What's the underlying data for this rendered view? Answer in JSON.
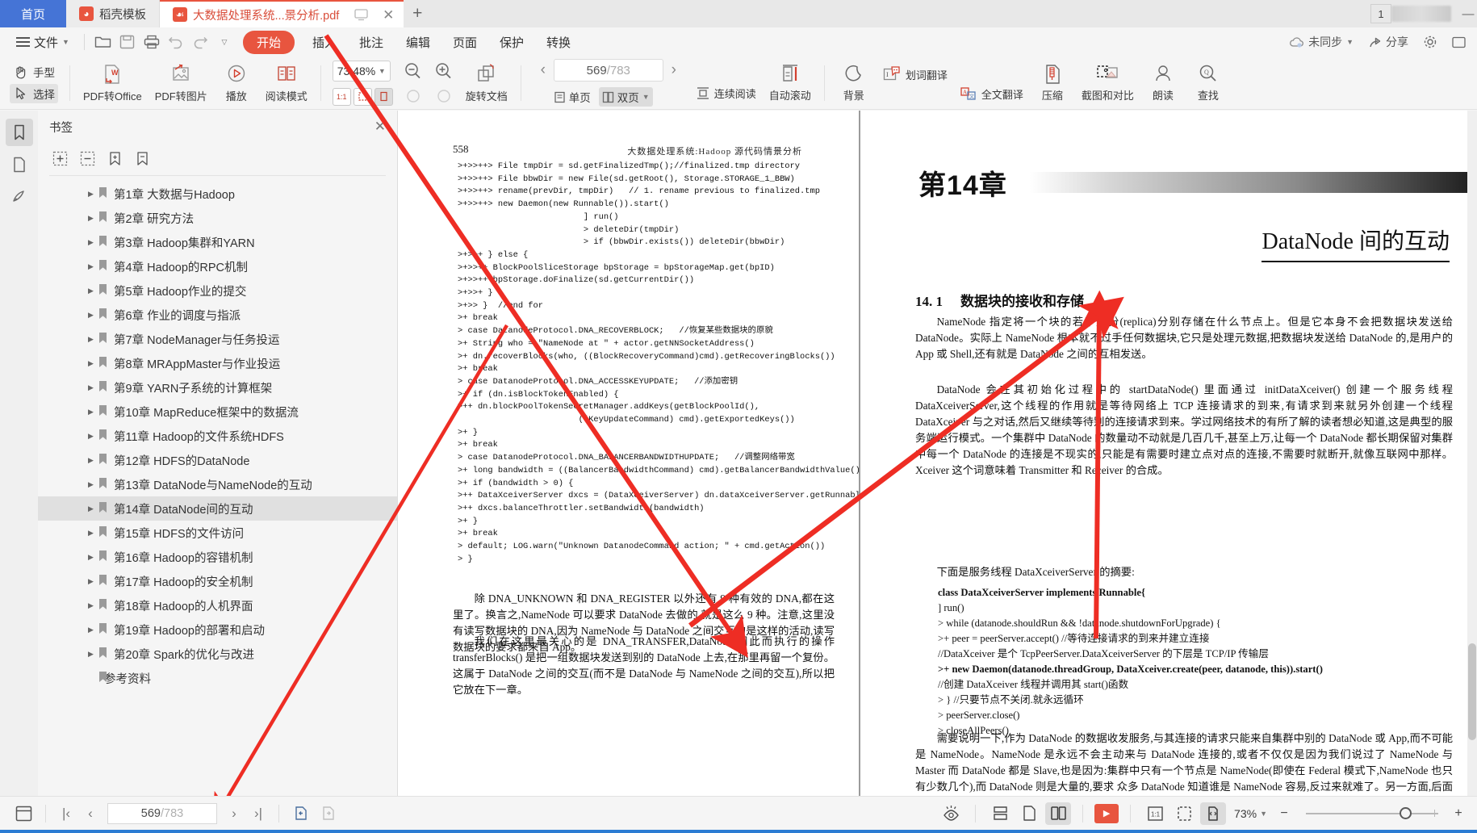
{
  "window": {
    "tabs": [
      {
        "label": "首页",
        "type": "home",
        "icon": "home-tab"
      },
      {
        "label": "稻壳模板",
        "type": "inactive",
        "icon": "wps-docer-icon"
      },
      {
        "label": "大数据处理系统...景分析.pdf",
        "type": "active",
        "icon": "pdf-icon"
      }
    ],
    "new_tab_label": "+",
    "badge": "1"
  },
  "menubar": {
    "file_label": "文件",
    "quick_icons": [
      "open-folder-icon",
      "save-icon",
      "print-icon",
      "undo-icon",
      "redo-icon",
      "customize-caret-icon"
    ],
    "tabs": [
      {
        "label": "开始",
        "active": true
      },
      {
        "label": "插入",
        "active": false
      },
      {
        "label": "批注",
        "active": false
      },
      {
        "label": "编辑",
        "active": false
      },
      {
        "label": "页面",
        "active": false
      },
      {
        "label": "保护",
        "active": false
      },
      {
        "label": "转换",
        "active": false
      }
    ],
    "right": [
      {
        "label": "未同步",
        "icon": "cloud-sync-icon"
      },
      {
        "label": "分享",
        "icon": "share-icon"
      },
      {
        "label": "",
        "icon": "gear-icon"
      },
      {
        "label": "",
        "icon": "window-icon"
      }
    ]
  },
  "ribbon": {
    "hand_tool": "手型",
    "select_tool": "选择",
    "buttons": [
      {
        "label": "PDF转Office",
        "icon": "pdf-to-office-icon",
        "dropdown": true
      },
      {
        "label": "PDF转图片",
        "icon": "pdf-to-image-icon",
        "dropdown": false
      },
      {
        "label": "播放",
        "icon": "play-circle-icon",
        "dropdown": false
      },
      {
        "label": "阅读模式",
        "icon": "reading-mode-icon",
        "dropdown": false
      }
    ],
    "zoom_value": "73.48%",
    "view_modes": [
      "1:1",
      "fit-page",
      "fit-width"
    ],
    "zoom_out_icon": "zoom-out-icon",
    "zoom_in_icon": "zoom-in-icon",
    "rotate_label": "旋转文档",
    "page_current": "569",
    "page_total": "783",
    "page_sep": "/",
    "single_page": "单页",
    "double_page": "双页",
    "continuous": "连续阅读",
    "autoscroll": "自动滚动",
    "background": "背景",
    "word_translate": "划词翻译",
    "full_translate": "全文翻译",
    "compress": "压缩",
    "screenshot_compare": "截图和对比",
    "read_aloud": "朗读",
    "find": "查找"
  },
  "rail": {
    "items": [
      {
        "icon": "bookmark-icon",
        "active": true
      },
      {
        "icon": "page-thumbnail-icon",
        "active": false
      },
      {
        "icon": "annotation-icon",
        "active": false
      }
    ]
  },
  "bookmarks": {
    "title": "书签",
    "close_icon": "close-icon",
    "tools": [
      "add-bookmark-icon",
      "remove-bookmark-icon",
      "edit-bookmark-icon",
      "goto-bookmark-icon"
    ],
    "items": [
      {
        "label": "第1章  大数据与Hadoop",
        "selected": false,
        "leaf": false
      },
      {
        "label": "第2章  研究方法",
        "selected": false,
        "leaf": false
      },
      {
        "label": "第3章  Hadoop集群和YARN",
        "selected": false,
        "leaf": false
      },
      {
        "label": "第4章  Hadoop的RPC机制",
        "selected": false,
        "leaf": false
      },
      {
        "label": "第5章  Hadoop作业的提交",
        "selected": false,
        "leaf": false
      },
      {
        "label": "第6章  作业的调度与指派",
        "selected": false,
        "leaf": false
      },
      {
        "label": "第7章  NodeManager与任务投运",
        "selected": false,
        "leaf": false
      },
      {
        "label": "第8章  MRAppMaster与作业投运",
        "selected": false,
        "leaf": false
      },
      {
        "label": "第9章  YARN子系统的计算框架",
        "selected": false,
        "leaf": false
      },
      {
        "label": "第10章  MapReduce框架中的数据流",
        "selected": false,
        "leaf": false
      },
      {
        "label": "第11章  Hadoop的文件系统HDFS",
        "selected": false,
        "leaf": false
      },
      {
        "label": "第12章  HDFS的DataNode",
        "selected": false,
        "leaf": false
      },
      {
        "label": "第13章  DataNode与NameNode的互动",
        "selected": false,
        "leaf": false
      },
      {
        "label": "第14章  DataNode间的互动",
        "selected": true,
        "leaf": false
      },
      {
        "label": "第15章  HDFS的文件访问",
        "selected": false,
        "leaf": false
      },
      {
        "label": "第16章  Hadoop的容错机制",
        "selected": false,
        "leaf": false
      },
      {
        "label": "第17章  Hadoop的安全机制",
        "selected": false,
        "leaf": false
      },
      {
        "label": "第18章  Hadoop的人机界面",
        "selected": false,
        "leaf": false
      },
      {
        "label": "第19章  Hadoop的部署和启动",
        "selected": false,
        "leaf": false
      },
      {
        "label": "第20章  Spark的优化与改进",
        "selected": false,
        "leaf": false
      },
      {
        "label": "参考资料",
        "selected": false,
        "leaf": true
      }
    ]
  },
  "document": {
    "left_page": {
      "page_number": "558",
      "running_head": "大数据处理系统:Hadoop 源代码情景分析",
      "code": ">+>>++> File tmpDir = sd.getFinalizedTmp();//finalized.tmp directory\n>+>>++> File bbwDir = new File(sd.getRoot(), Storage.STORAGE_1_BBW)\n>+>>++> rename(prevDir, tmpDir)   // 1. rename previous to finalized.tmp\n>+>>++> new Daemon(new Runnable()).start()\n                         ] run()\n                         > deleteDir(tmpDir)\n                         > if (bbwDir.exists()) deleteDir(bbwDir)\n>+>>+ } else {\n>+>>++ BlockPoolSliceStorage bpStorage = bpStorageMap.get(bpID)\n>+>>++ bpStorage.doFinalize(sd.getCurrentDir())\n>+>>+ }\n>+>> }  //end for\n>+ break\n> case DatanodeProtocol.DNA_RECOVERBLOCK;   //恢复某些数据块的原貌\n>+ String who = \"NameNode at \" + actor.getNNSocketAddress()\n>+ dn.recoverBlocks(who, ((BlockRecoveryCommand)cmd).getRecoveringBlocks())\n>+ break\n> case DatanodeProtocol.DNA_ACCESSKEYUPDATE;   //添加密钥\n>+ if (dn.isBlockTokenEnabled) {\n>++ dn.blockPoolTokenSecretManager.addKeys(getBlockPoolId(),\n                        ((KeyUpdateCommand) cmd).getExportedKeys())\n>+ }\n>+ break\n> case DatanodeProtocol.DNA_BALANCERBANDWIDTHUPDATE;   //调整网络带宽\n>+ long bandwidth = ((BalancerBandwidthCommand) cmd).getBalancerBandwidthValue()\n>+ if (bandwidth > 0) {\n>++ DataXceiverServer dxcs = (DataXceiverServer) dn.dataXceiverServer.getRunnable()\n>++ dxcs.balanceThrottler.setBandwidth(bandwidth)\n>+ }\n>+ break\n> default; LOG.warn(\"Unknown DatanodeCommand action; \" + cmd.getAction())\n> }",
      "paragraphs": [
        "除 DNA_UNKNOWN 和 DNA_REGISTER 以外还有 9 种有效的 DNA,都在这里了。换言之,NameNode 可以要求 DataNode 去做的,就是这么 9 种。注意,这里没有读写数据块的 DNA,因为 NameNode 与 DataNode 之间交互的是这样的活动,读写数据块的要求都来自 App。",
        "我们在这里最关心的是 DNA_TRANSFER,DataNode 因此而执行的操作 transferBlocks() 是把一组数据块发送到别的 DataNode 上去,在那里再留一个复份。这属于 DataNode 之间的交互(而不是 DataNode 与 NameNode 之间的交互),所以把它放在下一章。"
      ]
    },
    "right_page": {
      "chapter_number": "第14章",
      "chapter_title": "DataNode 间的互动",
      "section_number": "14. 1",
      "section_title": "数据块的接收和存储",
      "paragraphs": [
        "NameNode 指定将一个块的若干复份(replica)分别存储在什么节点上。但是它本身不会把数据块发送给 DataNode。实际上 NameNode 根本就不过手任何数据块,它只是处理元数据,把数据块发送给 DataNode 的,是用户的 App 或 Shell,还有就是 DataNode 之间的互相发送。",
        "DataNode 会在其初始化过程中的 startDataNode() 里面通过 initDataXceiver() 创建一个服务线程 DataXceiverServer,这个线程的作用就是等待网络上 TCP 连接请求的到来,有请求到来就另外创建一个线程 DataXceiver 与之对话,然后又继续等待别的连接请求到来。学过网络技术的有所了解的读者想必知道,这是典型的服务端运行模式。一个集群中 DataNode 的数量动不动就是几百几千,甚至上万,让每一个 DataNode 都长期保留对集群中每一个 DataNode 的连接是不现实的,只能是有需要时建立点对点的连接,不需要时就断开,就像互联网中那样。Xceiver 这个词意味着 Transmitter 和 Receiver 的合成。",
        "下面是服务线程 DataXceiverServer 的摘要:"
      ],
      "code_lines": [
        "class DataXceiverServer implements Runnable{",
        "] run()",
        "  > while (datanode.shouldRun && !datanode.shutdownForUpgrade) {",
        "  >+ peer = peerServer.accept()        //等待连接请求的到来并建立连接",
        "        //DataXceiver 是个 TcpPeerServer.DataXceiverServer 的下层是 TCP/IP 传输层",
        "  >+ new Daemon(datanode.threadGroup, DataXceiver.create(peer, datanode, this)).start()",
        "                                          //创建 DataXceiver 线程并调用其 start()函数",
        "  > } //只要节点不关闭.就永远循环",
        "  > peerServer.close()",
        "  > closeAllPeers()"
      ],
      "tail_paragraphs": [
        "需要说明一下,作为 DataNode 的数据收发服务,与其连接的请求只能来自集群中别的 DataNode 或 App,而不可能是 NameNode。NameNode 是永远不会主动来与 DataNode 连接的,或者不仅仅是因为我们说过了 NameNode 与 Master 而 DataNode 都是 Slave,也是因为:集群中只有一个节点是 NameNode(即使在 Federal 模式下,NameNode 也只有少数几个),而 DataNode 则是大量的,要求 众多 DataNode 知道谁是 NameNode 容易,反过来就难了。另一方面,后面我们会看到,数据块只是在 DataNode 之间的,或者在 DataNode 与 App 之间的流动。"
      ]
    }
  },
  "statusbar": {
    "left_icons": [
      "layout-icon"
    ],
    "first_page_icon": "first-page-icon",
    "prev_page_icon": "prev-page-icon",
    "page_current": "569",
    "page_sep": "/",
    "page_total": "783",
    "next_page_icon": "next-page-icon",
    "last_page_icon": "last-page-icon",
    "back_icon": "nav-back-icon",
    "forward_icon": "nav-forward-icon",
    "right_icons": [
      {
        "icon": "eye-reading-icon",
        "active": false
      },
      {
        "icon": "continuous-scroll-icon",
        "active": false
      },
      {
        "icon": "single-page-icon",
        "active": false
      },
      {
        "icon": "double-page-icon",
        "active": true
      },
      {
        "icon": "play-slideshow-icon",
        "active": false
      },
      {
        "icon": "actual-size-icon",
        "active": false
      },
      {
        "icon": "fit-page-icon",
        "active": false
      },
      {
        "icon": "fit-width-icon",
        "active": true
      }
    ],
    "zoom_label": "73%",
    "zoom_minus": "−",
    "zoom_plus": "+"
  },
  "colors": {
    "accent_red": "#e8553f",
    "home_tab_blue": "#4574d6",
    "annotation_red": "#ee2d24",
    "taskbar_blue": "#2b7cd3",
    "doc_bg": "#808080"
  }
}
